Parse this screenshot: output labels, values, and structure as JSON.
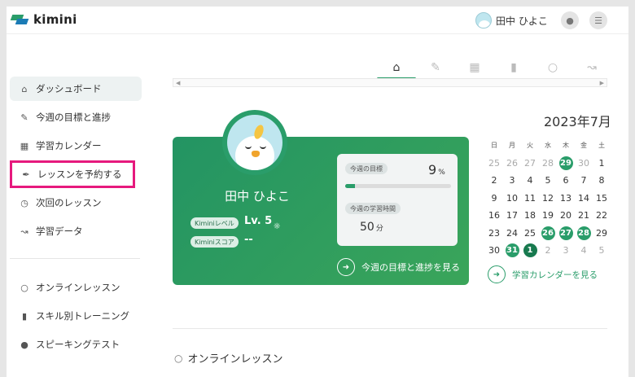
{
  "app": {
    "logo_text": "kimini"
  },
  "user": {
    "name": "田中 ひよこ"
  },
  "header_icons": [
    "chat-bubble-icon",
    "menu-icon"
  ],
  "sidebar": {
    "items": [
      {
        "label": "ダッシュボード",
        "icon": "home-icon"
      },
      {
        "label": "今週の目標と進捗",
        "icon": "pencil-icon"
      },
      {
        "label": "学習カレンダー",
        "icon": "calendar-icon"
      },
      {
        "label": "レッスンを予約する",
        "icon": "feather-icon"
      },
      {
        "label": "次回のレッスン",
        "icon": "alarm-clock-icon"
      },
      {
        "label": "学習データ",
        "icon": "line-chart-icon"
      }
    ],
    "items2": [
      {
        "label": "オンラインレッスン",
        "icon": "chat-bubble-icon"
      },
      {
        "label": "スキル別トレーニング",
        "icon": "book-icon"
      },
      {
        "label": "スピーキングテスト",
        "icon": "microphone-icon"
      }
    ]
  },
  "tabs": [
    "home-icon",
    "pencil-icon",
    "calendar-icon",
    "book-icon",
    "chat-bubble-icon",
    "line-chart-icon"
  ],
  "profile": {
    "name": "田中 ひよこ",
    "level_label": "Kiminiレベル",
    "level_value": "Lv. 5",
    "score_label": "Kiminiスコア",
    "score_value": "--"
  },
  "weekly": {
    "goal_label": "今週の目標",
    "goal_value": "9",
    "goal_unit": "%",
    "goal_progress": 0.09,
    "time_label": "今週の学習時間",
    "time_value": "50",
    "time_unit": "分",
    "link_text": "今週の目標と進捗を見る"
  },
  "calendar": {
    "title": "2023年7月",
    "weekdays": [
      "日",
      "月",
      "火",
      "水",
      "木",
      "金",
      "土"
    ],
    "weeks": [
      [
        {
          "d": "25",
          "m": 1
        },
        {
          "d": "26",
          "m": 1
        },
        {
          "d": "27",
          "m": 1
        },
        {
          "d": "28",
          "m": 1
        },
        {
          "d": "29",
          "s": 1
        },
        {
          "d": "30",
          "m": 1
        },
        {
          "d": "1"
        }
      ],
      [
        {
          "d": "2"
        },
        {
          "d": "3"
        },
        {
          "d": "4"
        },
        {
          "d": "5"
        },
        {
          "d": "6"
        },
        {
          "d": "7"
        },
        {
          "d": "8"
        }
      ],
      [
        {
          "d": "9"
        },
        {
          "d": "10"
        },
        {
          "d": "11"
        },
        {
          "d": "12"
        },
        {
          "d": "13"
        },
        {
          "d": "14"
        },
        {
          "d": "15"
        }
      ],
      [
        {
          "d": "16"
        },
        {
          "d": "17"
        },
        {
          "d": "18"
        },
        {
          "d": "19"
        },
        {
          "d": "20"
        },
        {
          "d": "21"
        },
        {
          "d": "22"
        }
      ],
      [
        {
          "d": "23"
        },
        {
          "d": "24"
        },
        {
          "d": "25"
        },
        {
          "d": "26",
          "s": 1
        },
        {
          "d": "27",
          "s": 1
        },
        {
          "d": "28",
          "s": 1
        },
        {
          "d": "29"
        }
      ],
      [
        {
          "d": "30"
        },
        {
          "d": "31",
          "s": 1
        },
        {
          "d": "1",
          "s": 2
        },
        {
          "d": "2",
          "m": 1
        },
        {
          "d": "3",
          "m": 1
        },
        {
          "d": "4",
          "m": 1
        },
        {
          "d": "5",
          "m": 1
        }
      ]
    ],
    "link_text": "学習カレンダーを見る"
  },
  "section": {
    "title": "オンラインレッスン"
  },
  "colors": {
    "accent": "#2a9d6a",
    "highlight": "#e6197d"
  }
}
